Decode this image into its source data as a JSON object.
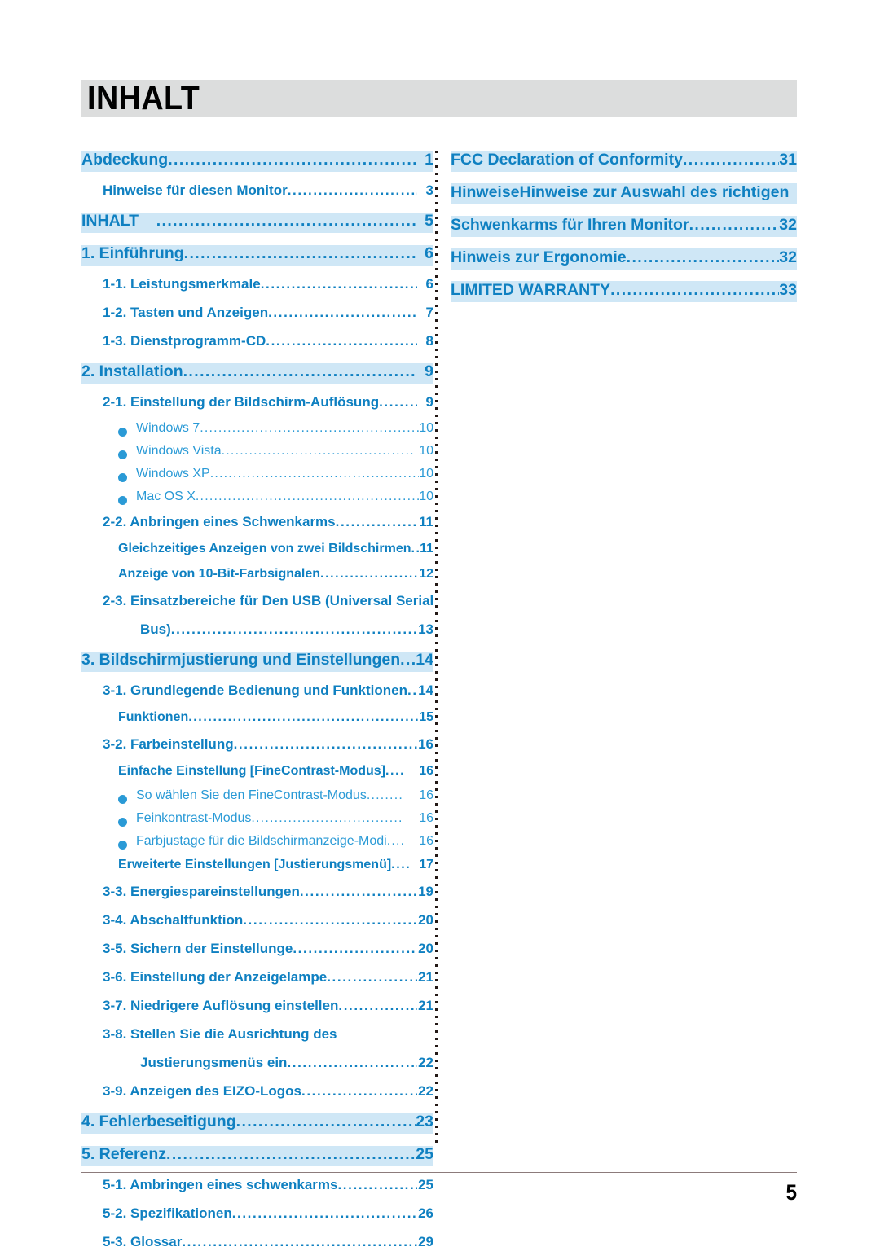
{
  "header": {
    "title": "INHALT",
    "band_color": "#dcdddd"
  },
  "colors": {
    "accent_blue": "#0f80c1",
    "light_blue": "#2a9ad6",
    "highlight_band": "#cfe7f6",
    "header_band": "#dcdddd",
    "footer_rule": "#8c7b7b"
  },
  "footer": {
    "page_number": "5"
  },
  "columns": {
    "left": [
      {
        "level": 1,
        "text": "Abdeckung",
        "page": "1",
        "leader": "......................................................",
        "band": true
      },
      {
        "level": 2,
        "text": "Hinweise für diesen Monitor",
        "page": "3",
        "leader": "......................................",
        "band": false
      },
      {
        "level": 1,
        "text": "INHALT",
        "page": "5",
        "leader": "..............................................................",
        "band": true,
        "gap": true
      },
      {
        "level": 1,
        "text": "1. Einführung",
        "page": "6",
        "leader": "................................................",
        "band": true
      },
      {
        "level": 2,
        "text": "1-1. Leistungsmerkmale",
        "page": "6",
        "leader": "..........................................",
        "band": false
      },
      {
        "level": 2,
        "text": "1-2. Tasten und Anzeigen",
        "page": "7",
        "leader": "........................................",
        "band": false
      },
      {
        "level": 2,
        "text": "1-3. Dienstprogramm-CD",
        "page": "8",
        "leader": "........................................",
        "band": false
      },
      {
        "level": 1,
        "text": "2. Installation",
        "page": "9",
        "leader": "................................................",
        "band": true
      },
      {
        "level": 2,
        "text": "2-1. Einstellung der Bildschirm-Auflösung",
        "page": "9",
        "leader": "...........",
        "band": false
      },
      {
        "level": 4,
        "text": "Windows 7",
        "page": "10",
        "leader": ".................................................",
        "band": false
      },
      {
        "level": 4,
        "text": "Windows Vista",
        "page": "10",
        "leader": "..........................................",
        "band": false
      },
      {
        "level": 4,
        "text": "Windows XP",
        "page": "10",
        "leader": "..............................................",
        "band": false
      },
      {
        "level": 4,
        "text": "Mac OS X",
        "page": "10",
        "leader": "..................................................",
        "band": false
      },
      {
        "level": 2,
        "text": "2-2. Anbringen eines Schwenkarms",
        "page": "11",
        "leader": ".....................",
        "band": false
      },
      {
        "level": 3,
        "text": "Gleichzeitiges Anzeigen von zwei Bildschirmen",
        "page": "11",
        "leader": "...",
        "band": false
      },
      {
        "level": 3,
        "text": "Anzeige von 10-Bit-Farbsignalen",
        "page": "12",
        "leader": ".....................",
        "band": false
      },
      {
        "level": 2,
        "text": "2-3. Einsatzbereiche für Den USB (Universal Serial",
        "page": "",
        "leader": "",
        "band": false,
        "wrap_first": true
      },
      {
        "level": 2,
        "text": "Bus)",
        "page": "13",
        "leader": "..................................................................",
        "band": false,
        "wrap_cont": true
      },
      {
        "level": 1,
        "text": "3. Bildschirmjustierung und Einstellungen",
        "page": "14",
        "leader": ".....",
        "band": true
      },
      {
        "level": 2,
        "text": "3-1. Grundlegende Bedienung und Funktionen",
        "page": "14",
        "leader": "...",
        "band": false
      },
      {
        "level": 3,
        "text": "Funktionen",
        "page": "15",
        "leader": "................................................",
        "band": false
      },
      {
        "level": 2,
        "text": "3-2. Farbeinstellung",
        "page": "16",
        "leader": ".................................................",
        "band": false
      },
      {
        "level": 3,
        "text": "Einfache Einstellung [FineContrast-Modus]",
        "page": "16",
        "leader": "....",
        "band": false
      },
      {
        "level": 4,
        "text": "So wählen Sie den FineContrast-Modus",
        "page": "16",
        "leader": "........",
        "band": false
      },
      {
        "level": 4,
        "text": "Feinkontrast-Modus",
        "page": "16",
        "leader": ".................................",
        "band": false
      },
      {
        "level": 4,
        "text": "Farbjustage für die Bildschirmanzeige-Modi",
        "page": "16",
        "leader": "....",
        "band": false
      },
      {
        "level": 3,
        "text": "Erweiterte Einstellungen [Justierungsmenü]",
        "page": "17",
        "leader": "....",
        "band": false
      },
      {
        "level": 2,
        "text": "3-3. Energiespareinstellungen",
        "page": "19",
        "leader": "...............................",
        "band": false
      },
      {
        "level": 2,
        "text": "3-4. Abschaltfunktion",
        "page": "20",
        "leader": "...........................................",
        "band": false
      },
      {
        "level": 2,
        "text": "3-5. Sichern der Einstellunge",
        "page": "20",
        "leader": "................................",
        "band": false
      },
      {
        "level": 2,
        "text": "3-6. Einstellung der Anzeigelampe",
        "page": "21",
        "leader": ".......................",
        "band": false
      },
      {
        "level": 2,
        "text": "3-7. Niedrigere Auflösung einstellen",
        "page": "21",
        "leader": "....................",
        "band": false
      },
      {
        "level": 2,
        "text": "3-8. Stellen Sie die Ausrichtung des",
        "page": "",
        "leader": "",
        "band": false,
        "wrap_first": true
      },
      {
        "level": 2,
        "text": "Justierungsmenüs ein",
        "page": "22",
        "leader": "........................................",
        "band": false,
        "wrap_cont": true
      },
      {
        "level": 2,
        "text": "3-9. Anzeigen des EIZO-Logos",
        "page": "22",
        "leader": "............................",
        "band": false
      },
      {
        "level": 1,
        "text": "4. Fehlerbeseitigung",
        "page": "23",
        "leader": "...........................................",
        "band": true
      },
      {
        "level": 1,
        "text": "5. Referenz",
        "page": "25",
        "leader": "....................................................",
        "band": true
      },
      {
        "level": 2,
        "text": "5-1. Ambringen eines schwenkarms",
        "page": "25",
        "leader": "...................",
        "band": false
      },
      {
        "level": 2,
        "text": "5-2. Spezifikationen",
        "page": "26",
        "leader": "...............................................",
        "band": false
      },
      {
        "level": 2,
        "text": "5-3. Glossar",
        "page": "29",
        "leader": "..............................................................",
        "band": false
      }
    ],
    "right": [
      {
        "level": 1,
        "text": "FCC Declaration of Conformity",
        "page": "31",
        "leader": ".........................",
        "band": true
      },
      {
        "level": 1,
        "text": "HinweiseHinweise zur Auswahl des richtigen",
        "page": "",
        "leader": "",
        "band": true,
        "wrap_first": true
      },
      {
        "level": 1,
        "text": "Schwenkarms für Ihren Monitor",
        "page": "32",
        "leader": "........................",
        "band": true
      },
      {
        "level": 1,
        "text": "Hinweis zur Ergonomie",
        "page": "32",
        "leader": ".....................................",
        "band": true
      },
      {
        "level": 1,
        "text": "LIMITED WARRANTY",
        "page": "33",
        "leader": "..........................................",
        "band": true
      }
    ]
  }
}
